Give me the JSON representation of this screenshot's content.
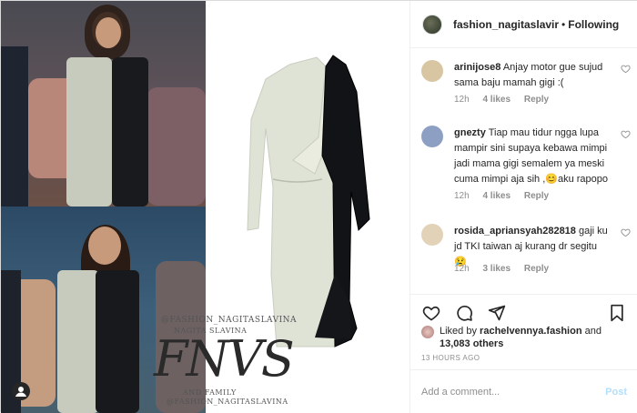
{
  "post": {
    "owner": "fashion_nagitaslavir",
    "separator": "•",
    "follow_status": "Following"
  },
  "comments": [
    {
      "username": "arinijose8",
      "text": "Anjay motor gue sujud sama baju mamah gigi :(",
      "time": "12h",
      "likes": "4 likes",
      "reply": "Reply",
      "avatar_color": "#d8c6a3"
    },
    {
      "username": "gnezty",
      "text": "Tiap mau tidur ngga lupa mampir sini supaya kebawa mimpi jadi mama gigi semalem ya meski cuma mimpi aja sih ,😊aku rapopo",
      "time": "12h",
      "likes": "4 likes",
      "reply": "Reply",
      "avatar_color": "#8da0c4"
    },
    {
      "username": "rosida_apriansyah282818",
      "text": "gaji ku jd TKI taiwan aj kurang dr segitu😢",
      "time": "12h",
      "likes": "3 likes",
      "reply": "Reply",
      "avatar_color": "#e2d3b8"
    }
  ],
  "likes": {
    "prefix": "Liked by",
    "user": "rachelvennya.fashion",
    "joiner": "and",
    "others": "13,083 others"
  },
  "timestamp": "13 HOURS AGO",
  "add_comment": {
    "placeholder": "Add a comment...",
    "post_label": "Post"
  },
  "media": {
    "watermark_top": "@FASHION_NAGITASLAVINA",
    "watermark_sub": "NAGITA SLAVINA",
    "watermark_mono": "FNVS",
    "watermark_family": "AND FAMILY",
    "watermark_bottom": "@FASHION_NAGITASLAVINA"
  },
  "colors": {
    "accent_blue": "#0095f6",
    "post_disabled": "#b2dffc",
    "muted": "#8e8e8e",
    "text": "#262626"
  },
  "icons": [
    "heart-icon",
    "comment-icon",
    "share-icon",
    "bookmark-icon",
    "user-tag-icon"
  ]
}
